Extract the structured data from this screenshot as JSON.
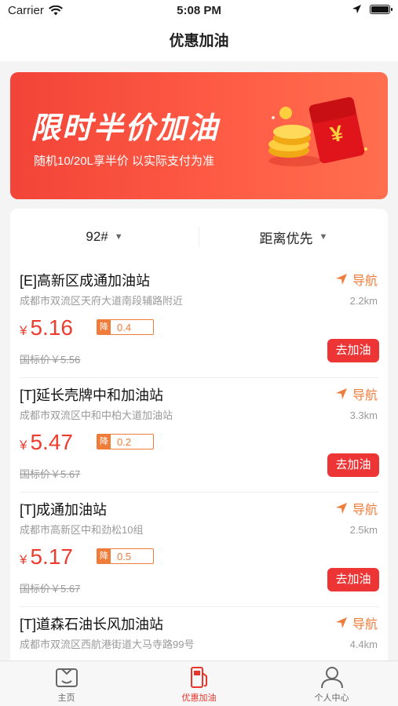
{
  "status_bar": {
    "carrier": "Carrier",
    "time": "5:08 PM"
  },
  "nav": {
    "title": "优惠加油"
  },
  "banner": {
    "title": "限时半价加油",
    "subtitle": "随机10/20L享半价 以实际支付为准",
    "envelope_symbol": "¥"
  },
  "filters": {
    "fuel": "92#",
    "sort": "距离优先"
  },
  "labels": {
    "navigate": "导航",
    "go": "去加油",
    "drop_tag": "降",
    "yen": "¥"
  },
  "stations": [
    {
      "name": "[E]高新区成通加油站",
      "address": "成都市双流区天府大道南段辅路附近",
      "distance": "2.2km",
      "price": "5.16",
      "drop": "0.4",
      "standard": "国标价￥5.56"
    },
    {
      "name": "[T]延长壳牌中和加油站",
      "address": "成都市双流区中和中柏大道加油站",
      "distance": "3.3km",
      "price": "5.47",
      "drop": "0.2",
      "standard": "国标价￥5.67"
    },
    {
      "name": "[T]成通加油站",
      "address": "成都市高新区中和劲松10组",
      "distance": "2.5km",
      "price": "5.17",
      "drop": "0.5",
      "standard": "国标价￥5.67"
    },
    {
      "name": "[T]道森石油长风加油站",
      "address": "成都市双流区西航港街道大马寺路99号",
      "distance": "4.4km"
    }
  ],
  "tabs": [
    {
      "label": "主页",
      "icon": "home-icon"
    },
    {
      "label": "优惠加油",
      "icon": "fuel-pump-icon"
    },
    {
      "label": "个人中心",
      "icon": "person-icon"
    }
  ],
  "colors": {
    "accent": "#ee3c2f",
    "nav_orange": "#f07c3a",
    "banner_start": "#f24438",
    "banner_end": "#ff6f4e"
  }
}
